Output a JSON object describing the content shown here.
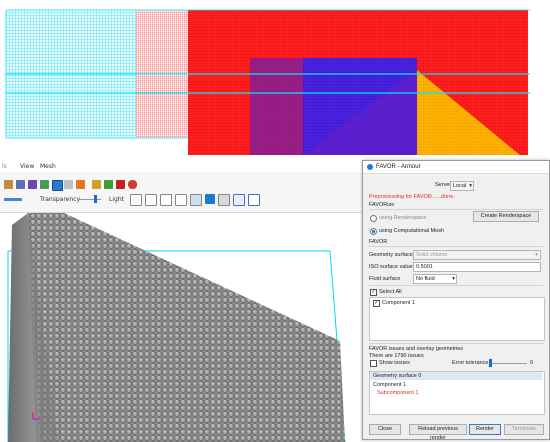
{
  "menu": {
    "items": [
      "View",
      "Mesh"
    ]
  },
  "toolbar": {
    "transparency_label": "Transparency",
    "light_label": "Light"
  },
  "dialog": {
    "title": "FAVOR - Armour",
    "server_label": "Server",
    "server_value": "Local",
    "status_text": "Preprocessing for FAVOR......done.",
    "favorize_label": "FAVORize",
    "using_renderspace": "using Renderspace",
    "create_renderspace": "Create Renderspace",
    "using_mesh": "using Computational Mesh",
    "favor_section": "FAVOR",
    "geometry_surface_label": "Geometry surface",
    "geometry_surface_value": "Solid volume",
    "iso_label": "ISO surface value",
    "iso_value": "0.5001",
    "fluid_surface_label": "Fluid surface",
    "fluid_surface_value": "No fluid",
    "select_all": "Select All",
    "component_1": "Component 1",
    "issues_section": "FAVOR issues and overlay geometries",
    "issues_count": "There are 1790 issues",
    "show_issues": "Show issues",
    "error_tolerance": "Error tolerance",
    "tolerance_value": "0",
    "tree_header": "Geometry surface 0",
    "tree_component": "Component 1",
    "tree_subcomponent": "Subcomponent 1",
    "buttons": {
      "close": "Close",
      "reload": "Reload previous render",
      "render": "Render",
      "terminate": "Terminate"
    }
  },
  "colors": {
    "mesh_red": "#ff1a1a",
    "mesh_cyan": "#00e5ff",
    "mesh_blue": "#3b1fd6",
    "mesh_orange": "#ffb000",
    "status": "#e0301e"
  }
}
